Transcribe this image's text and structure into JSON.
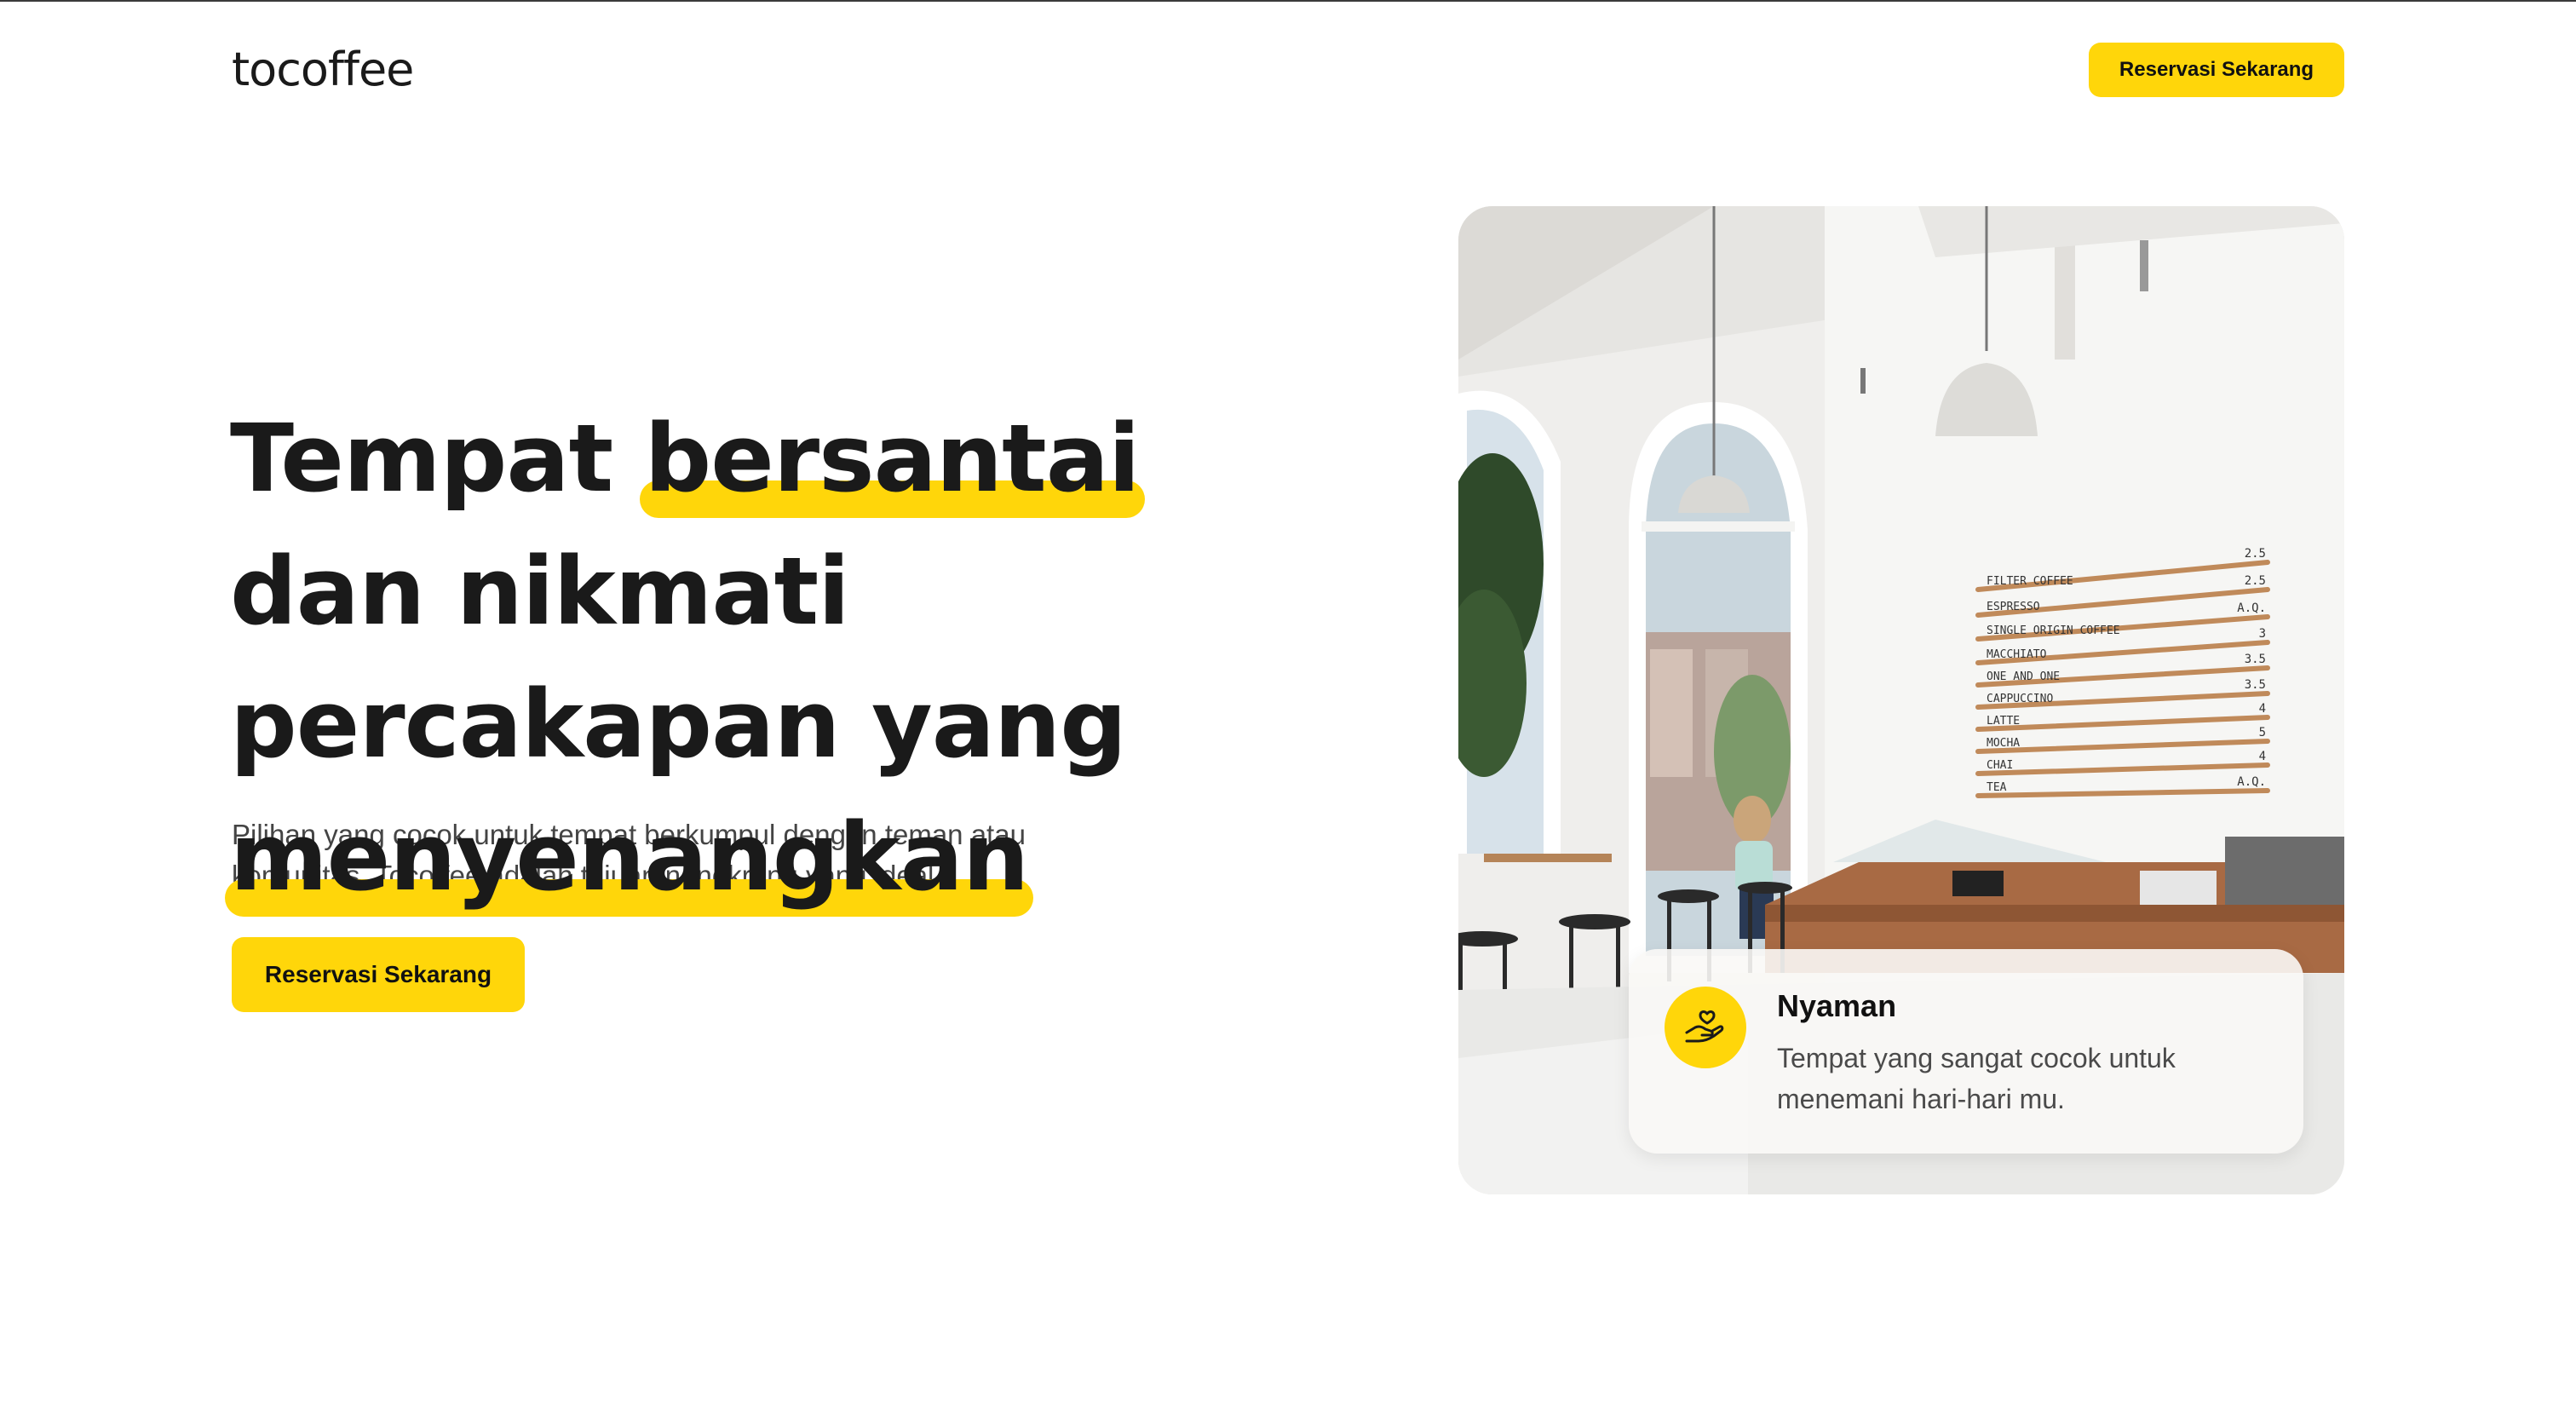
{
  "header": {
    "logo": "tocoffee",
    "cta_label": "Reservasi Sekarang"
  },
  "hero": {
    "headline_part1": "Tempat ",
    "headline_highlight1": "bersantai",
    "headline_part2": " dan nikmati percakapan yang ",
    "headline_highlight2": "menyenangkan",
    "description": "Pilihan yang cocok untuk tempat berkumpul dengan teman atau komunitas. Tocoffee adalah tujuan nongkrong yang ideal.",
    "cta_label": "Reservasi Sekarang"
  },
  "feature_card": {
    "icon": "hand-heart-icon",
    "title": "Nyaman",
    "description": "Tempat yang sangat cocok untuk menemani hari-hari mu."
  },
  "menu_board": {
    "items": [
      "FILTER COFFEE",
      "ESPRESSO",
      "SINGLE ORIGIN COFFEE",
      "MACCHIATO",
      "ONE AND ONE",
      "CAPPUCCINO",
      "LATTE",
      "MOCHA",
      "CHAI",
      "TEA"
    ],
    "prices": [
      "2.5",
      "2.5",
      "A.Q.",
      "3",
      "3.5",
      "3.5",
      "4",
      "5",
      "4",
      "A.Q."
    ]
  },
  "colors": {
    "accent": "#FFD60A",
    "text": "#1a1a1a",
    "muted": "#444444"
  }
}
